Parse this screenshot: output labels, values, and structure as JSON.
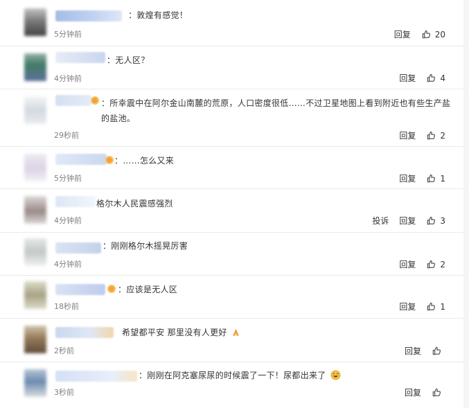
{
  "actions": {
    "reply": "回复",
    "report": "投诉"
  },
  "comments": [
    {
      "text": "：敦煌有感觉！",
      "time": "5分钟前",
      "likes": "20"
    },
    {
      "text": "：无人区？",
      "time": "4分钟前",
      "likes": "4"
    },
    {
      "text": "：所幸震中在阿尔金山南麓的荒原，人口密度很低……不过卫星地图上看到附近也有些生产盐的盐池。",
      "time": "29秒前",
      "likes": "2"
    },
    {
      "text": "：……怎么又来",
      "time": "5分钟前",
      "likes": "1"
    },
    {
      "text": "格尔木人民震感强烈",
      "time": "4分钟前",
      "likes": "3"
    },
    {
      "text": "：刚刚格尔木摇晃厉害",
      "time": "4分钟前",
      "likes": "2"
    },
    {
      "text": "：应该是无人区",
      "time": "18秒前",
      "likes": "1"
    },
    {
      "text": "希望都平安 那里没有人更好",
      "time": "2秒前",
      "likes": ""
    },
    {
      "text": "：刚刚在阿克塞尿尿的时候震了一下！尿都出来了",
      "time": "3秒前",
      "likes": ""
    }
  ],
  "colors": {
    "link_blue": "#3f6fb6",
    "meta_gray": "#808080",
    "text": "#333333",
    "background": "#ffffff"
  },
  "icons": {
    "like": "thumbs-up-icon",
    "emoji": "emoji-icon",
    "pray": "praying-hands-icon",
    "laugh": "laughing-face-icon"
  }
}
